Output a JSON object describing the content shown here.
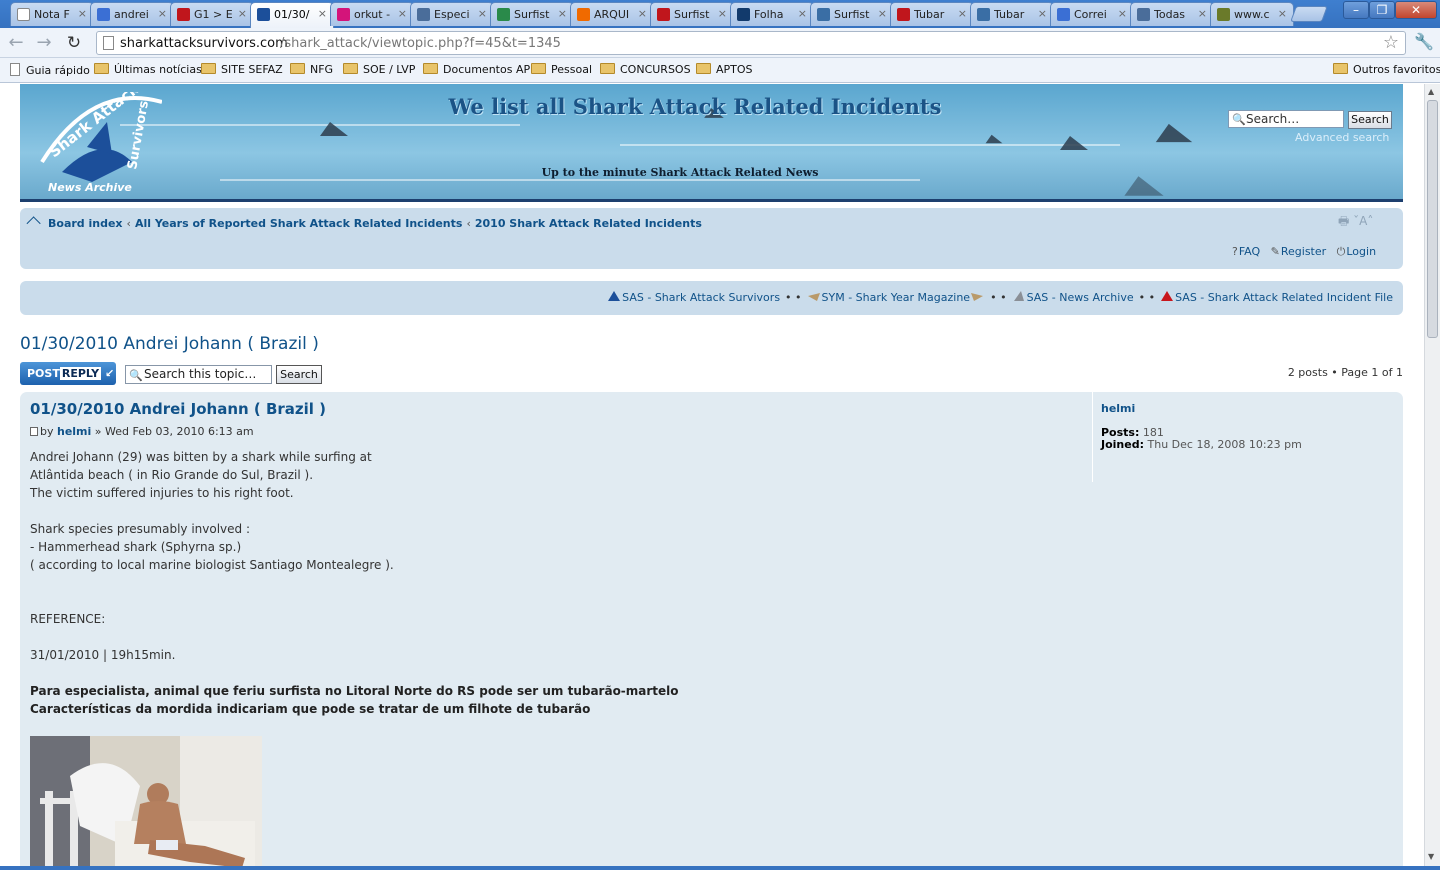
{
  "browser": {
    "tabs": [
      {
        "title": "Nota F",
        "icon": "page-icon",
        "color": "#ffffff"
      },
      {
        "title": "andrei",
        "icon": "google-icon",
        "color": "#3b6fd4"
      },
      {
        "title": "G1 > E",
        "icon": "g1-icon",
        "color": "#c0161c"
      },
      {
        "title": "01/30/",
        "icon": "shark-icon",
        "color": "#1c4f9a",
        "active": true
      },
      {
        "title": "orkut -",
        "icon": "orkut-icon",
        "color": "#d4147a"
      },
      {
        "title": "Especi",
        "icon": "newspaper-icon",
        "color": "#4a6d9a"
      },
      {
        "title": "Surfist",
        "icon": "globe-icon",
        "color": "#2a8a4a"
      },
      {
        "title": "ARQUI",
        "icon": "blogger-icon",
        "color": "#f06a00"
      },
      {
        "title": "Surfist",
        "icon": "clicrbs-icon",
        "color": "#c0161c"
      },
      {
        "title": "Folha",
        "icon": "folha-icon",
        "color": "#123a6c"
      },
      {
        "title": "Surfist",
        "icon": "podcast-icon",
        "color": "#3a6ea5"
      },
      {
        "title": "Tubar",
        "icon": "guia-icon",
        "color": "#c0161c"
      },
      {
        "title": "Tubar",
        "icon": "wordpress-icon",
        "color": "#3a6ea5"
      },
      {
        "title": "Correi",
        "icon": "google-icon",
        "color": "#3b6fd4"
      },
      {
        "title": "Todas",
        "icon": "newspaper-icon",
        "color": "#4a6d9a"
      },
      {
        "title": "www.c",
        "icon": "binoculars-icon",
        "color": "#6a7a2a"
      }
    ],
    "url_host": "sharkattacksurvivors.com",
    "url_path": "/shark_attack/viewtopic.php?f=45&t=1345",
    "bookmarks": [
      {
        "label": "Guia rápido",
        "type": "page"
      },
      {
        "label": "Últimas notícias",
        "type": "folder"
      },
      {
        "label": "SITE SEFAZ",
        "type": "folder"
      },
      {
        "label": "NFG",
        "type": "folder"
      },
      {
        "label": "SOE / LVP",
        "type": "folder"
      },
      {
        "label": "Documentos AP",
        "type": "folder"
      },
      {
        "label": "Pessoal",
        "type": "folder"
      },
      {
        "label": "CONCURSOS",
        "type": "folder"
      },
      {
        "label": "APTOS",
        "type": "folder"
      }
    ],
    "other_bookmarks": "Outros favoritos"
  },
  "header": {
    "logo_line1": "Shark Attack",
    "logo_line2": "Survivors",
    "logo_caption": "News Archive",
    "title": "We list all Shark Attack Related Incidents",
    "subtitle": "Up to the minute Shark Attack Related News",
    "search_placeholder": "Search…",
    "search_button": "Search",
    "advanced_search": "Advanced search"
  },
  "nav": {
    "breadcrumbs": [
      "Board index",
      "All Years of Reported Shark Attack Related Incidents",
      "2010 Shark Attack Related Incidents"
    ],
    "faq": "FAQ",
    "register": "Register",
    "login": "Login",
    "site_links": [
      "SAS - Shark Attack Survivors",
      "SYM - Shark Year Magazine",
      "SAS - News Archive",
      "SAS - Shark Attack Related Incident File"
    ]
  },
  "topic": {
    "title": "01/30/2010 Andrei Johann ( Brazil )",
    "post_reply": "POST",
    "post_reply_b": "REPLY",
    "search_placeholder": "Search this topic…",
    "search_button": "Search",
    "pagination": "2 posts • Page 1 of 1"
  },
  "post": {
    "title": "01/30/2010 Andrei Johann ( Brazil )",
    "by": "by",
    "author": "helmi",
    "date": "» Wed Feb 03, 2010 6:13 am",
    "body": {
      "l1": "Andrei Johann (29) was bitten by a shark while surfing at",
      "l2": "Atlântida beach ( in Rio Grande do Sul, Brazil ).",
      "l3": "The victim suffered injuries to his right foot.",
      "l4": "Shark species presumably involved :",
      "l5": "- Hammerhead shark (Sphyrna sp.)",
      "l6": "( according to local marine biologist Santiago Montealegre ).",
      "l7": "REFERENCE:",
      "l8": "31/01/2010 | 19h15min.",
      "l9": "Para especialista, animal que feriu surfista no Litoral Norte do RS pode ser um tubarão-martelo",
      "l10": "Características da mordida indicariam que pode se tratar de um filhote de tubarão"
    },
    "profile": {
      "author": "helmi",
      "posts_label": "Posts:",
      "posts_value": "181",
      "joined_label": "Joined:",
      "joined_value": "Thu Dec 18, 2008 10:23 pm"
    }
  }
}
